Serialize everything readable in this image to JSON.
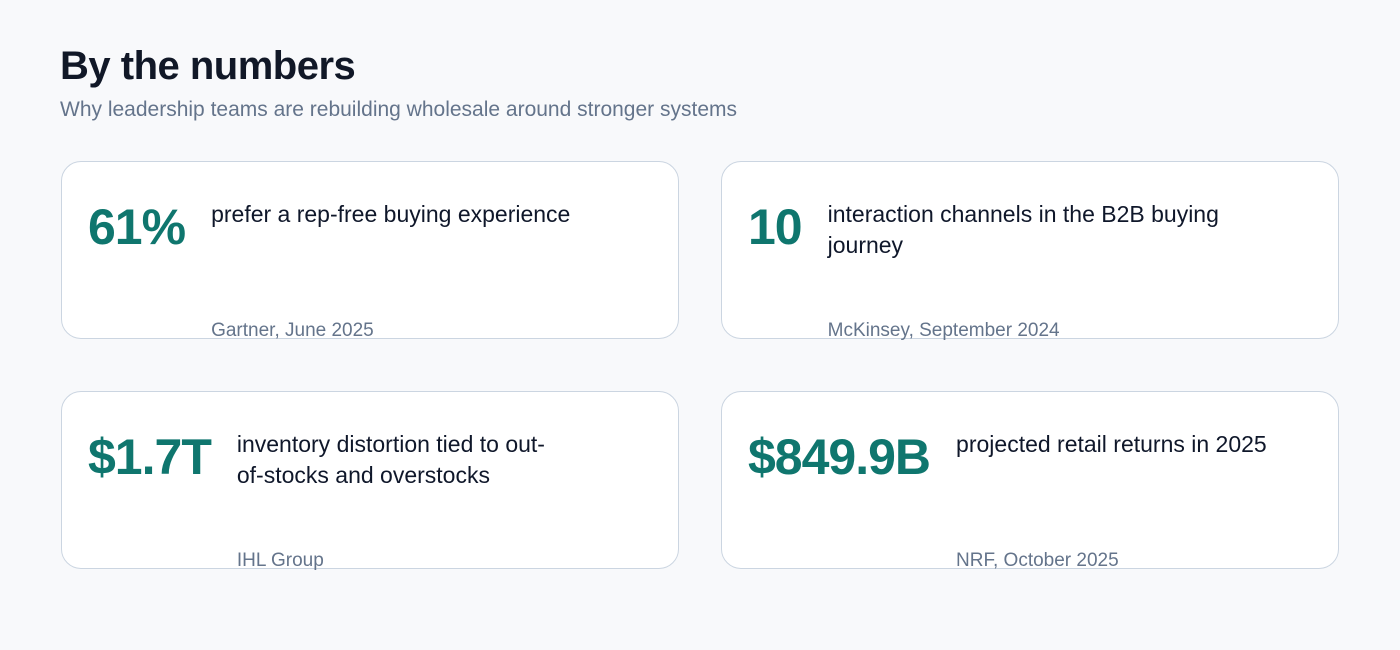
{
  "header": {
    "title": "By the numbers",
    "subtitle": "Why leadership teams are rebuilding wholesale around stronger systems"
  },
  "stats": [
    {
      "value": "61%",
      "description": "prefer a rep-free buying experience",
      "source": "Gartner, June 2025"
    },
    {
      "value": "10",
      "description": "interaction channels in the B2B buying journey",
      "source": "McKinsey, September 2024"
    },
    {
      "value": "$1.7T",
      "description": "inventory distortion tied to out-of-stocks and overstocks",
      "source": "IHL Group"
    },
    {
      "value": "$849.9B",
      "description": "projected retail returns in 2025",
      "source": "NRF, October 2025"
    }
  ],
  "colors": {
    "accent": "#0f766e",
    "title": "#111827",
    "muted": "#64748b",
    "card_border": "#cbd5e1",
    "background": "#f8f9fb"
  }
}
